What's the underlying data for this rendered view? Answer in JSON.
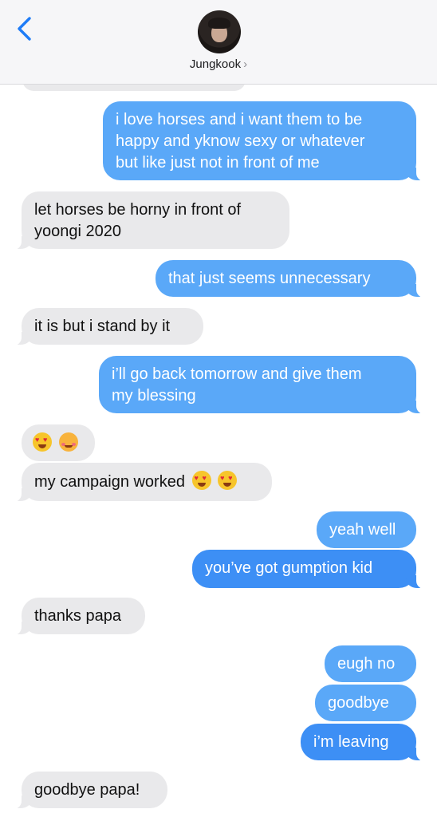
{
  "header": {
    "contact_name": "Jungkook",
    "chevron": "›",
    "back_icon": "chevron-left-icon"
  },
  "messages": [
    {
      "id": "m1",
      "side": "out",
      "lines": [
        "i love horses and i want them to be",
        "happy and yknow sexy or whatever",
        "but like just not in front of me"
      ]
    },
    {
      "id": "m2",
      "side": "in",
      "lines": [
        "let horses be horny in front of",
        "yoongi 2020"
      ]
    },
    {
      "id": "m3",
      "side": "out",
      "lines": [
        "that just seems unnecessary"
      ]
    },
    {
      "id": "m4",
      "side": "in",
      "lines": [
        "it is but i stand by it"
      ]
    },
    {
      "id": "m5",
      "side": "out",
      "lines": [
        "i’ll go back tomorrow and give them",
        "my blessing"
      ]
    },
    {
      "id": "m6",
      "side": "in",
      "emoji": [
        "heart-eyes",
        "smiling-hearts"
      ]
    },
    {
      "id": "m7",
      "side": "in",
      "lines": [
        "my campaign worked"
      ],
      "emoji": [
        "heart-eyes",
        "heart-eyes"
      ]
    },
    {
      "id": "m8",
      "side": "out",
      "lines": [
        "yeah well"
      ]
    },
    {
      "id": "m9",
      "side": "out",
      "lines": [
        "you’ve got gumption kid"
      ]
    },
    {
      "id": "m10",
      "side": "in",
      "lines": [
        "thanks papa"
      ]
    },
    {
      "id": "m11",
      "side": "out",
      "lines": [
        "eugh no"
      ]
    },
    {
      "id": "m12",
      "side": "out",
      "lines": [
        "goodbye"
      ]
    },
    {
      "id": "m13",
      "side": "out",
      "lines": [
        "i’m leaving"
      ]
    },
    {
      "id": "m14",
      "side": "in",
      "lines": [
        "goodbye papa!"
      ]
    }
  ],
  "colors": {
    "outgoing": "#3d8ff5",
    "incoming": "#e9e9eb",
    "accent": "#1e7cf7"
  }
}
